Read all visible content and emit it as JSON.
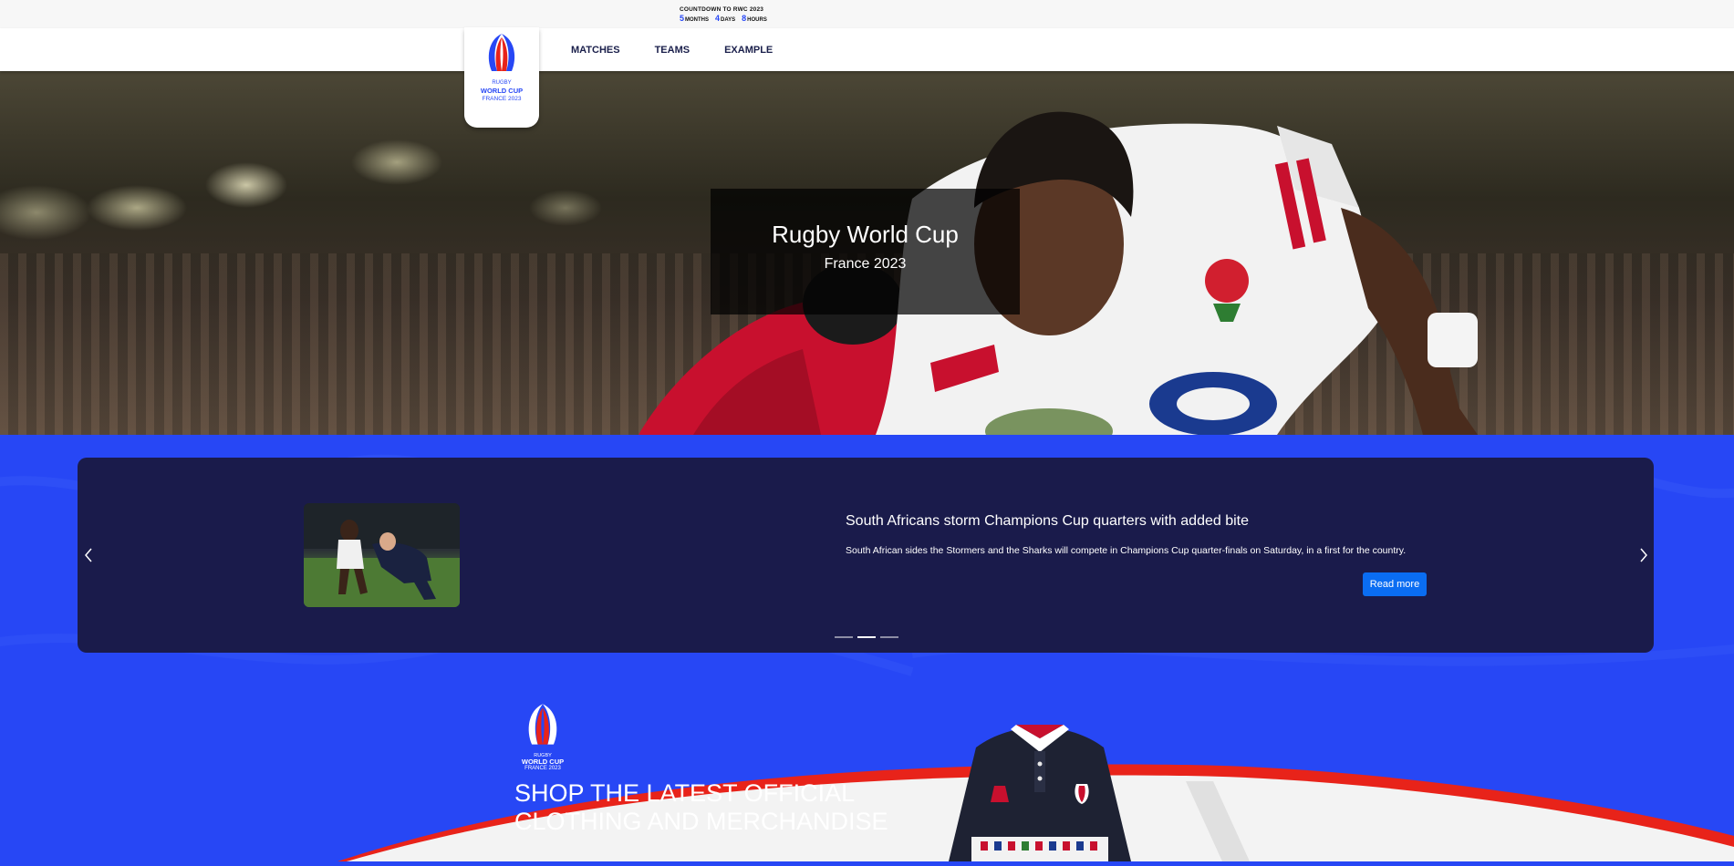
{
  "countdown": {
    "title": "COUNTDOWN TO RWC 2023",
    "items": [
      {
        "value": "5",
        "unit": "MONTHS"
      },
      {
        "value": "4",
        "unit": "DAYS"
      },
      {
        "value": "8",
        "unit": "HOURS"
      }
    ]
  },
  "logo": {
    "line1": "RUGBY",
    "line2": "WORLD CUP",
    "line3": "FRANCE 2023"
  },
  "nav": {
    "items": [
      "MATCHES",
      "TEAMS",
      "EXAMPLE"
    ]
  },
  "hero": {
    "title": "Rugby World Cup",
    "subtitle": "France 2023"
  },
  "news": {
    "slides_count": 3,
    "active_slide": 2,
    "headline": "South Africans storm Champions Cup quarters with added bite",
    "text": "South African sides the Stormers and the Sharks will compete in Champions Cup quarter-finals on Saturday, in a first for the country.",
    "read_more": "Read more"
  },
  "shop": {
    "logo_line1": "RUGBY",
    "logo_line2": "WORLD CUP",
    "logo_line3": "FRANCE 2023",
    "heading": "SHOP THE LATEST OFFICIAL CLOTHING AND MERCHANDISE"
  },
  "colors": {
    "brand_blue": "#2747f5",
    "card_navy": "#1a1b4b",
    "button_blue": "#0a6df2",
    "accent_red": "#e8231a"
  }
}
